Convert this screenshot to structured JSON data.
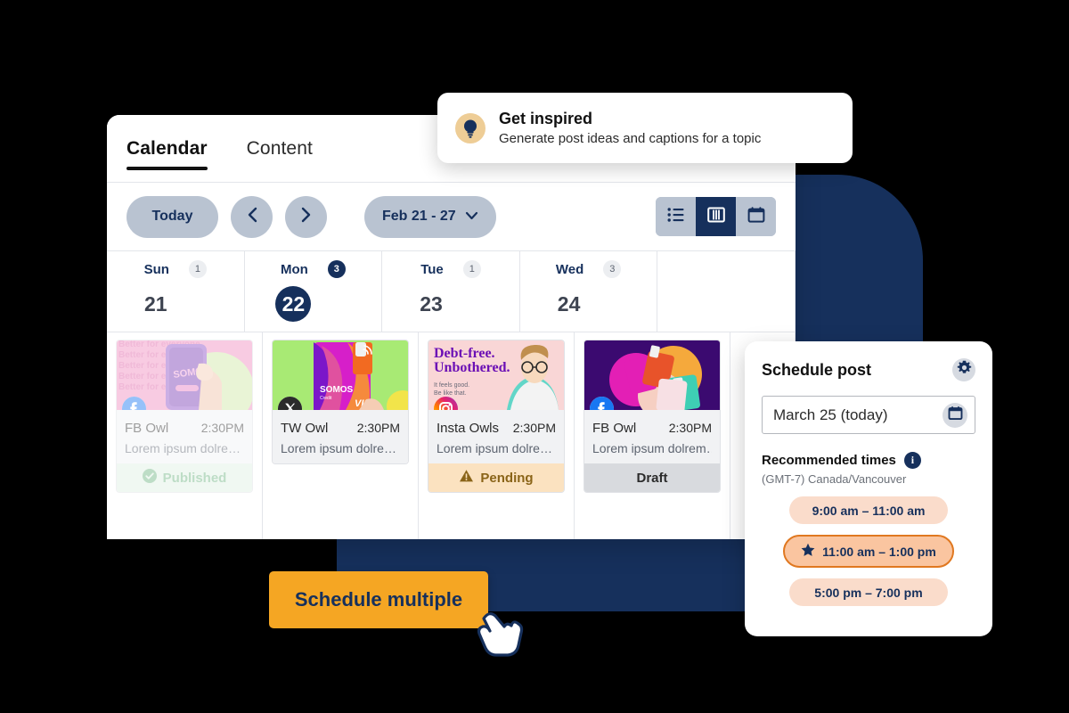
{
  "colors": {
    "navy": "#16305c",
    "accent_orange": "#f5a623",
    "pill_gray": "#b9c3d1",
    "published_green": "#6fb483",
    "pending_amber": "#8a6418",
    "slot_peach": "#fadccb",
    "slot_selected_border": "#e07820"
  },
  "window": {
    "tabs": [
      {
        "label": "Calendar",
        "active": true,
        "name": "tab-calendar"
      },
      {
        "label": "Content",
        "active": false,
        "name": "tab-content"
      }
    ]
  },
  "toolbar": {
    "today_label": "Today",
    "prev_icon": "chevron-left-icon",
    "next_icon": "chevron-right-icon",
    "range_label": "Feb 21 - 27",
    "range_chevron_icon": "chevron-down-icon",
    "views": [
      {
        "icon": "list-view-icon",
        "active": false
      },
      {
        "icon": "column-view-icon",
        "active": true
      },
      {
        "icon": "month-calendar-view-icon",
        "active": false
      }
    ]
  },
  "get_inspired": {
    "icon": "lightbulb-icon",
    "title": "Get inspired",
    "subtitle": "Generate post ideas and captions for a topic"
  },
  "calendar": {
    "days": [
      {
        "dow": "Sun",
        "count": "1",
        "daynum": "21",
        "today": false
      },
      {
        "dow": "Mon",
        "count": "3",
        "daynum": "22",
        "today": true
      },
      {
        "dow": "Tue",
        "count": "1",
        "daynum": "23",
        "today": false
      },
      {
        "dow": "Wed",
        "count": "3",
        "daynum": "24",
        "today": false
      },
      {
        "dow": "",
        "count": "",
        "daynum": "",
        "today": false
      }
    ],
    "posts": [
      {
        "network_icon": "facebook-icon",
        "account": "FB Owl",
        "time": "2:30PM",
        "preview_text": "Lorem ipsum dolre…",
        "status": "Published",
        "status_icon": "check-circle-icon",
        "faded": true
      },
      {
        "network_icon": "x-twitter-icon",
        "account": "TW Owl",
        "time": "2:30PM",
        "preview_text": "Lorem ipsum dolre…",
        "status": "",
        "status_icon": "",
        "faded": false
      },
      {
        "network_icon": "instagram-icon",
        "account": "Insta Owls",
        "time": "2:30PM",
        "preview_text": "Lorem ipsum dolre…",
        "status": "Pending",
        "status_icon": "warning-triangle-icon",
        "faded": false
      },
      {
        "network_icon": "facebook-icon",
        "account": "FB Owl",
        "time": "2:30PM",
        "preview_text": "Lorem ipsum dolrem…",
        "status": "Draft",
        "status_icon": "",
        "faded": false
      }
    ],
    "thumb_texts": {
      "card1_repeat": "Better",
      "card1_repeat2": "for everyone",
      "card1_brand": "SOMOS",
      "card2_brand": "SOMOS",
      "card2_brand_sub": "Credit",
      "card2_visa": "VIS",
      "card3_head1": "Debt-free.",
      "card3_head2": "Unbothered.",
      "card3_sub1": "It feels good.",
      "card3_sub2": "Be like that."
    }
  },
  "schedule_panel": {
    "title": "Schedule post",
    "gear_icon": "gear-icon",
    "date_value": "March 25 (today)",
    "calendar_icon": "calendar-icon",
    "recommended_label": "Recommended times",
    "info_icon": "info-icon",
    "timezone": "(GMT-7) Canada/Vancouver",
    "slots": [
      {
        "label": "9:00 am – 11:00 am",
        "selected": false,
        "star": false
      },
      {
        "label": "11:00 am – 1:00 pm",
        "selected": true,
        "star": true
      },
      {
        "label": "5:00 pm – 7:00 pm",
        "selected": false,
        "star": false
      }
    ],
    "star_icon": "star-icon"
  },
  "cta": {
    "label": "Schedule multiple",
    "cursor_icon": "hand-pointer-cursor-icon"
  }
}
